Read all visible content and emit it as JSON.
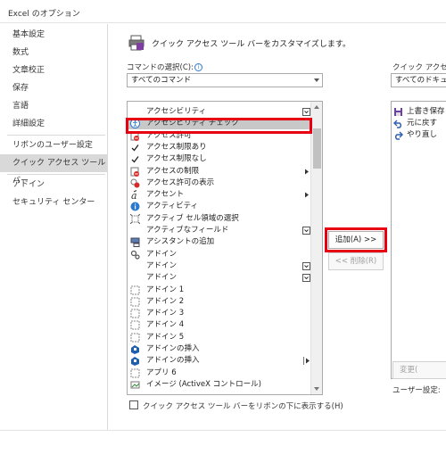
{
  "window": {
    "title": "Excel のオプション"
  },
  "sidebar": {
    "items": [
      {
        "label": "基本設定"
      },
      {
        "label": "数式"
      },
      {
        "label": "文章校正"
      },
      {
        "label": "保存"
      },
      {
        "label": "言語"
      },
      {
        "label": "詳細設定"
      },
      {
        "label": "リボンのユーザー設定"
      },
      {
        "label": "クイック アクセス ツール バー"
      },
      {
        "label": "アドイン"
      },
      {
        "label": "セキュリティ センター"
      }
    ],
    "selected": "クイック アクセス ツール バー"
  },
  "main": {
    "header": "クイック アクセス ツール バーをカスタマイズします。",
    "commands_label": "コマンドの選択(C):",
    "commands_value": "すべてのコマンド",
    "qat_label": "クイック アクセス ツ",
    "qat_value": "すべてのドキュメント",
    "command_list": [
      {
        "label": "アクセシビリティ",
        "icon": "none-icon",
        "submenu": "dropdown"
      },
      {
        "label": "アクセシビリティ チェック",
        "icon": "accessibility-check-icon",
        "selected": true
      },
      {
        "label": "アクセス許可",
        "icon": "permission-icon"
      },
      {
        "label": "アクセス制限あり",
        "icon": "check-icon"
      },
      {
        "label": "アクセス制限なし",
        "icon": "check-icon"
      },
      {
        "label": "アクセスの制限",
        "icon": "restrict-icon",
        "submenu": "arrow"
      },
      {
        "label": "アクセス許可の表示",
        "icon": "view-permission-icon"
      },
      {
        "label": "アクセント",
        "icon": "accent-icon",
        "submenu": "arrow"
      },
      {
        "label": "アクティビティ",
        "icon": "info-icon"
      },
      {
        "label": "アクティブ セル領域の選択",
        "icon": "select-region-icon"
      },
      {
        "label": "アクティブなフィールド",
        "icon": "none-icon",
        "submenu": "dropdown"
      },
      {
        "label": "アシスタントの追加",
        "icon": "assistant-icon"
      },
      {
        "label": "アドイン",
        "icon": "addin-gear-icon"
      },
      {
        "label": "アドイン",
        "icon": "none-icon",
        "submenu": "dropdown"
      },
      {
        "label": "アドイン",
        "icon": "none-icon",
        "submenu": "dropdown"
      },
      {
        "label": "アドイン 1",
        "icon": "addin-box-icon"
      },
      {
        "label": "アドイン 2",
        "icon": "addin-box-icon"
      },
      {
        "label": "アドイン 3",
        "icon": "addin-box-icon"
      },
      {
        "label": "アドイン 4",
        "icon": "addin-box-icon"
      },
      {
        "label": "アドイン 5",
        "icon": "addin-box-icon"
      },
      {
        "label": "アドインの挿入",
        "icon": "insert-addin-icon"
      },
      {
        "label": "アドインの挿入",
        "icon": "insert-addin-icon",
        "submenu": "split"
      },
      {
        "label": "アプリ 6",
        "icon": "addin-box-icon"
      },
      {
        "label": "イメージ (ActiveX コントロール)",
        "icon": "image-control-icon"
      }
    ],
    "add_button": "追加(A) >>",
    "remove_button": "<< 削除(R)",
    "qat_list": [
      {
        "label": "上書き保存",
        "icon": "save-icon"
      },
      {
        "label": "元に戻す",
        "icon": "undo-icon"
      },
      {
        "label": "やり直し",
        "icon": "redo-icon"
      }
    ],
    "modify_button": "変更(",
    "user_settings_label": "ユーザー設定:",
    "show_below_ribbon": "クイック アクセス ツール バーをリボンの下に表示する(H)"
  },
  "colors": {
    "highlight": "#e60012",
    "selected_row": "#c8c8c8"
  }
}
